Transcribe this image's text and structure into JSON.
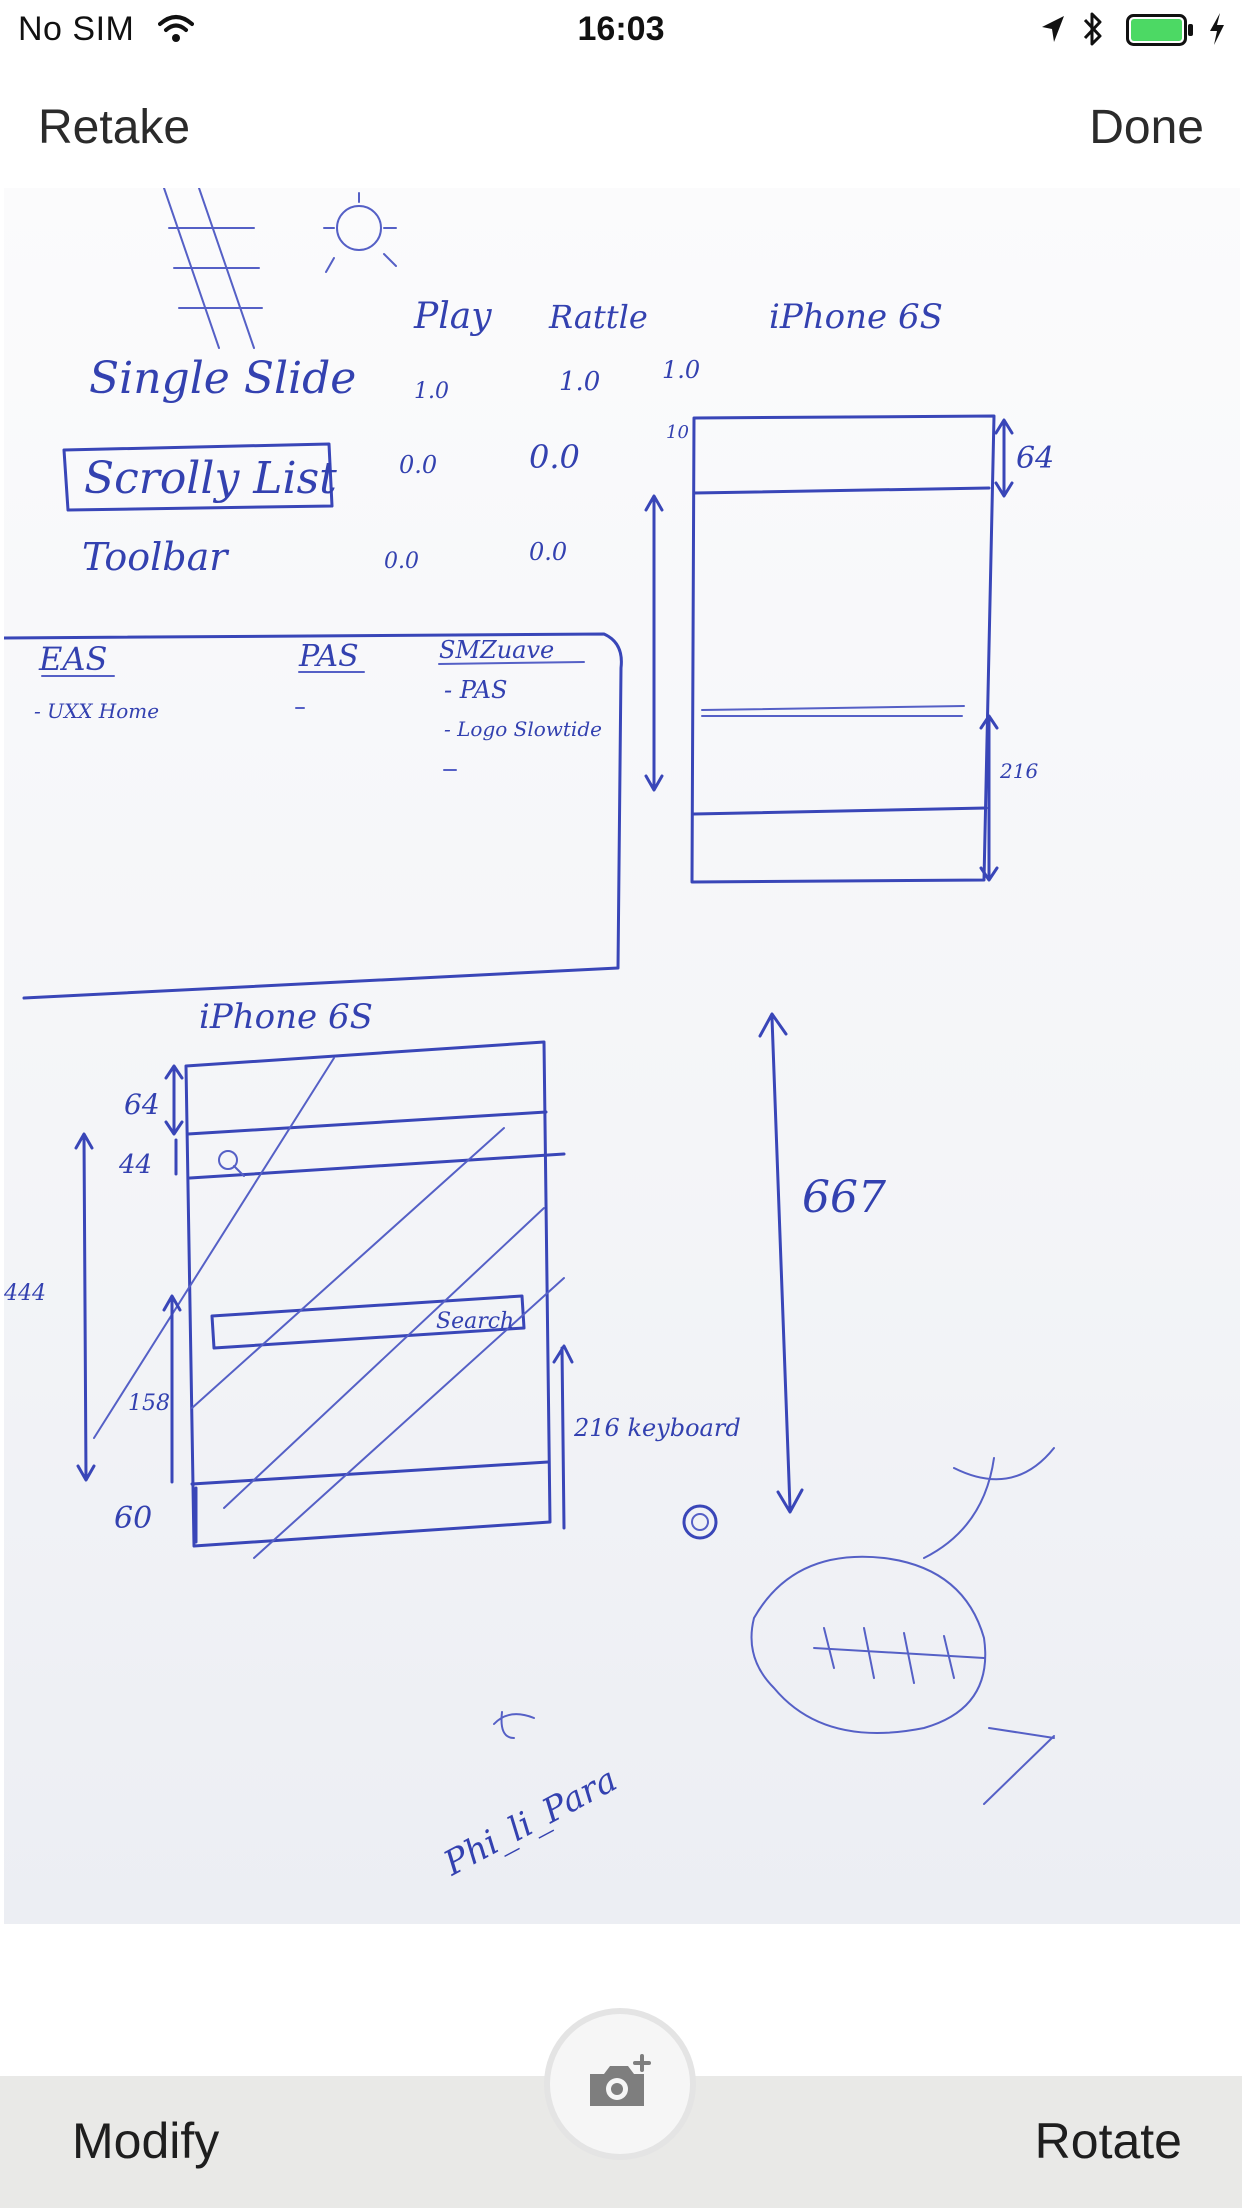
{
  "status_bar": {
    "carrier": "No SIM",
    "time": "16:03",
    "battery_color": "#4cd964"
  },
  "nav": {
    "retake_label": "Retake",
    "done_label": "Done"
  },
  "photo": {
    "sketch_text": {
      "play": "Play",
      "rattle": "Rattle",
      "iphone6s_top": "iPhone 6S",
      "single_slide": "Single Slide",
      "scrolling_list": "Scrolly List",
      "toolbar": "Toolbar",
      "v1": "1.0",
      "v2": "1.0",
      "v3": "1.0",
      "v4": "0.0",
      "v5": "0.0",
      "v6": "0.0",
      "v7": "0.0",
      "eas": "EAS",
      "pas": "PAS",
      "smeuave": "SMZuave",
      "uxx": "- UXX Home",
      "pas2": "- PAS",
      "logo": "- Logo Slowtide",
      "n64a": "64",
      "n216a": "216",
      "n10": "10",
      "iphone6s_bottom": "iPhone 6S",
      "n64b": "64",
      "n44": "44",
      "n444": "444",
      "n158": "158",
      "n60": "60",
      "search": "Search",
      "n216b": "216 keyboard",
      "n667": "667",
      "signature": "Phi_li_Para"
    }
  },
  "toolbar": {
    "modify_label": "Modify",
    "rotate_label": "Rotate"
  },
  "icons": {
    "wifi": "wifi-icon",
    "location": "location-arrow-icon",
    "bluetooth": "bluetooth-icon",
    "battery": "battery-icon",
    "charging": "charging-bolt-icon",
    "camera": "camera-add-icon"
  }
}
